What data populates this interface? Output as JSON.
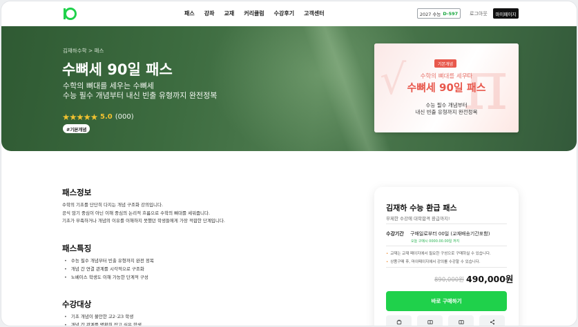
{
  "header": {
    "nav": [
      "패스",
      "강좌",
      "교재",
      "커리큘럼",
      "수강후기",
      "고객센터"
    ],
    "dday_label": "2027 수능",
    "dday_value": "D-597",
    "login": "로그아웃",
    "mypage": "마이페이지"
  },
  "hero": {
    "breadcrumb": "김재하수학 > 패스",
    "title": "수뼈세 90일 패스",
    "subtitle_line1": "수학의 뼈대를 세우는 수뼈세",
    "subtitle_line2": "수능 필수 개념부터 내신 빈출 유형까지 완전정복",
    "stars": "★★★★★",
    "score": "5.0",
    "count": "(000)",
    "tag": "#기본개념",
    "thumbnail": {
      "badge": "기본개념",
      "sub": "수학의 뼈대를 세우다",
      "title": "수뼈세 90일 패스",
      "line1": "수능 필수 개념부터",
      "line2": "내신 빈출 유형까지 완전정복"
    }
  },
  "sections": {
    "info_title": "패스정보",
    "info_lines": [
      "수학의 기초를 단단히 다지는 개념 구조화 강의입니다.",
      "공식 암기 중심이 아닌 이해 중심의 논리적 흐름으로 수학의 뼈대를 세워줍니다.",
      "기초가 부족하거나 개념의 이유를 이해하지 못했던 학생들에게 가장 적합한 단계입니다."
    ],
    "feature_title": "패스특징",
    "feature_items": [
      "수능 필수 개념부터 빈출 유형까지 완전 정복",
      "개념 간 연결 관계를 시각적으로 구조화",
      "노베이스 학생도 이해 가능한 단계적 구성"
    ],
    "target_title": "수강대상",
    "target_items": [
      "기초 개념이 불안한 고2·고3 학생",
      "개념 간 관계를 명확히 잡고 싶은 학생"
    ]
  },
  "card": {
    "title": "김재하 수능 환급 패스",
    "desc": "무제한 수강에 대학합격 환급까지!",
    "period_label": "수강기간",
    "period_value": "구매일로부터 00일 (교재배송기간포함)",
    "period_note": "오늘 구매시 0000.00.00일 까지",
    "note1": "교재는 교재 페이지에서 필요한 구성으로 구매하실 수 있습니다.",
    "note2": "상품구매 후, 마이페이지에서 강의를 수강할 수 있습니다.",
    "old_price": "890,000원",
    "price": "490,000원",
    "buy": "바로 구매하기",
    "icons": [
      "cart-icon",
      "book-icon",
      "coupon-icon",
      "share-icon"
    ]
  },
  "colors": {
    "brand_green": "#1fd14b",
    "hero_green": "#3c6b3f",
    "accent_red": "#e8584c",
    "star": "#f2c230"
  }
}
